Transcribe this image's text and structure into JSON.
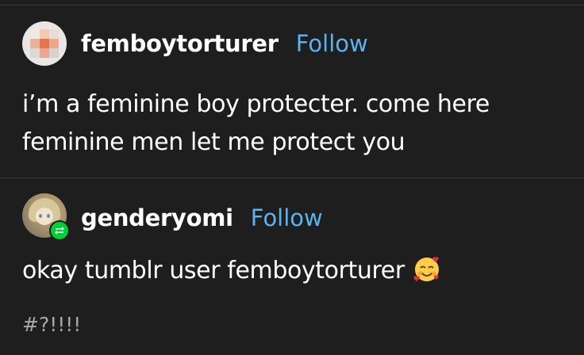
{
  "posts": [
    {
      "username": "femboytorturer",
      "follow_label": "Follow",
      "text": "i’m a feminine boy protecter. come here feminine men let me protect you",
      "avatar_icon": "pixelated-avatar"
    },
    {
      "username": "genderyomi",
      "follow_label": "Follow",
      "text": "okay tumblr user femboytorturer",
      "emoji_icon": "smiling-face-with-hearts",
      "tags": "#?!!!!",
      "avatar_icon": "anime-avatar",
      "badge_icon": "reblog-icon"
    }
  ],
  "colors": {
    "background": "#1e1e1e",
    "text": "#ffffff",
    "follow": "#5ab3f0",
    "tag": "#a8a8a8",
    "divider": "#3a3a3a",
    "reblog_badge": "#00cf35"
  }
}
